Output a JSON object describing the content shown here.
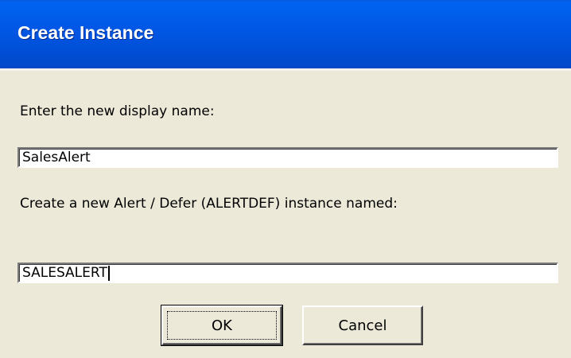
{
  "window": {
    "title": "Create Instance"
  },
  "form": {
    "display_name_label": "Enter the new display name:",
    "display_name_value": "SalesAlert",
    "instance_label": "Create a new Alert / Defer (ALERTDEF) instance named:",
    "instance_value": "SALESALERT"
  },
  "buttons": {
    "ok_label": "OK",
    "cancel_label": "Cancel"
  },
  "colors": {
    "titlebar": "#0058e6",
    "dialog_background": "#ece9d8"
  }
}
